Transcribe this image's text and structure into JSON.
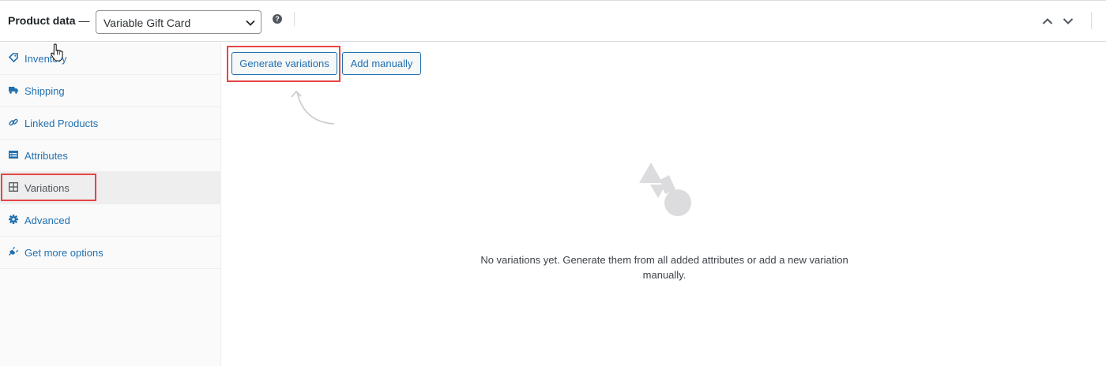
{
  "header": {
    "title": "Product data",
    "title_dash": " —",
    "product_type": "Variable Gift Card",
    "help": "?"
  },
  "sidebar": {
    "items": [
      {
        "label": "Inventory",
        "icon": "tag-icon"
      },
      {
        "label": "Shipping",
        "icon": "truck-icon"
      },
      {
        "label": "Linked Products",
        "icon": "link-icon"
      },
      {
        "label": "Attributes",
        "icon": "list-table-icon"
      },
      {
        "label": "Variations",
        "icon": "grid-icon",
        "active": true
      },
      {
        "label": "Advanced",
        "icon": "gear-icon"
      },
      {
        "label": "Get more options",
        "icon": "plug-icon"
      }
    ]
  },
  "main": {
    "generate_label": "Generate variations",
    "add_manually_label": "Add manually",
    "empty_message": "No variations yet. Generate them from all added attributes or add a new variation manually."
  },
  "colors": {
    "link": "#2271b1",
    "highlight": "#e64545",
    "active_tab_bg": "#eeeeee"
  }
}
